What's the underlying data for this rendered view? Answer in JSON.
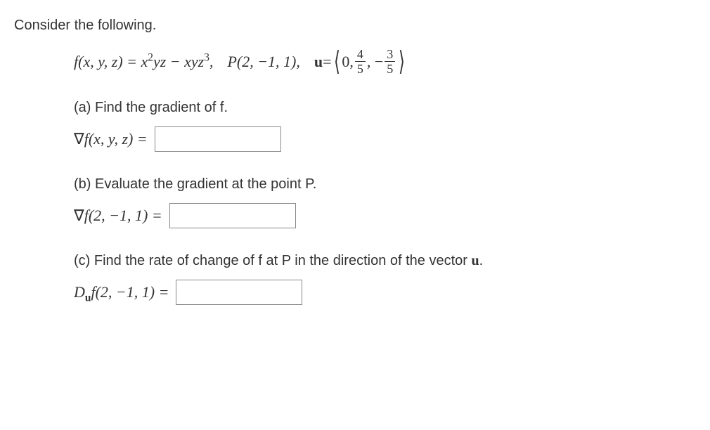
{
  "intro": "Consider the following.",
  "given": {
    "func_lhs": "f(x, y, z) = ",
    "func_rhs_part1": "x",
    "func_rhs_exp1": "2",
    "func_rhs_part2": "yz − xyz",
    "func_rhs_exp2": "3",
    "func_rhs_comma": ",",
    "point": "P(2, −1, 1),",
    "u_label": "u",
    "u_equals": " = ",
    "u_v0": "0, ",
    "u_v1_num": "4",
    "u_v1_den": "5",
    "u_comma": ", −",
    "u_v2_num": "3",
    "u_v2_den": "5"
  },
  "parts": {
    "a": {
      "label": "(a) Find the gradient of f.",
      "expr_prefix": "∇",
      "expr_mid": "f(x, y, z) = "
    },
    "b": {
      "label": "(b) Evaluate the gradient at the point P.",
      "expr_prefix": "∇",
      "expr_mid": "f(2, −1, 1) = "
    },
    "c": {
      "label": "(c) Find the rate of change of f at P in the direction of the vector ",
      "label_bold": "u",
      "label_end": ".",
      "expr_D": "D",
      "expr_sub": "u",
      "expr_mid": "f(2, −1, 1) = "
    }
  }
}
